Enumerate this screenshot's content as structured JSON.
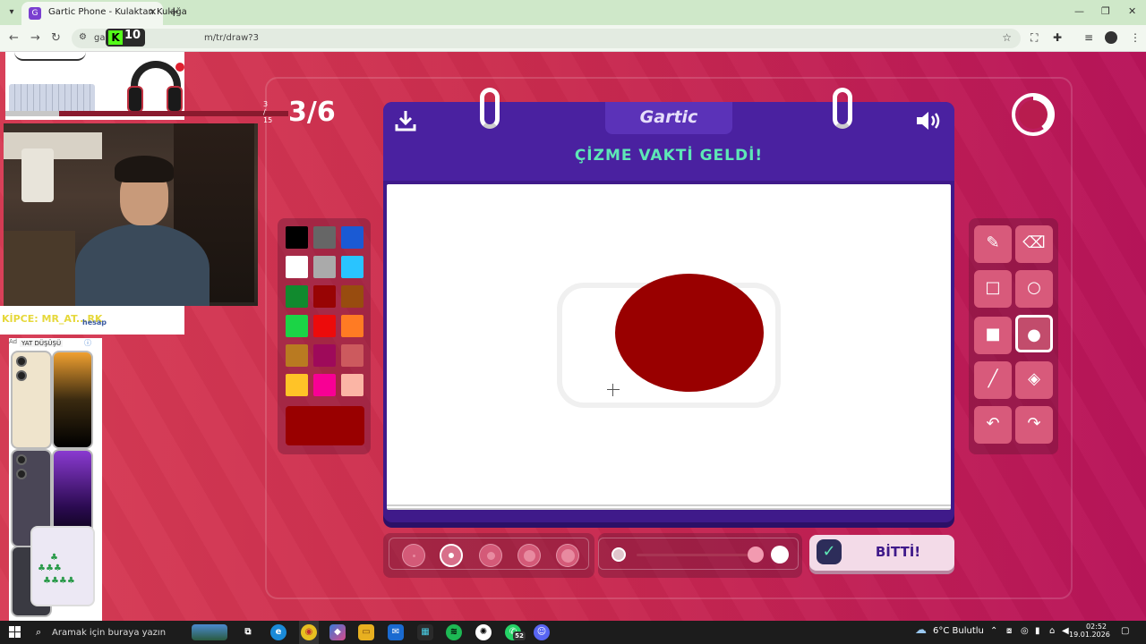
{
  "browser": {
    "tab_title": "Gartic Phone - Kulaktan Kulağa",
    "url_visible": "gart",
    "url_rest": "m/tr/draw?3",
    "kick_badge_number": "10"
  },
  "game": {
    "round": "3/6",
    "logo": "Gartic",
    "heading": "ÇİZME VAKTİ GELDİ!",
    "done_button": "BİTTİ!",
    "timer_elapsed_fraction": 0.6,
    "palette_colors": [
      "#000000",
      "#666666",
      "#1a5ad4",
      "#ffffff",
      "#aaaaaa",
      "#29c4ff",
      "#118a2e",
      "#980404",
      "#984c0f",
      "#1bd446",
      "#ec0b0b",
      "#ff7b23",
      "#b97a21",
      "#9e0a5a",
      "#cc5a5e",
      "#ffc327",
      "#f80094",
      "#fbb5a5"
    ],
    "selected_color": "#990000",
    "drawing": {
      "shape": "ellipse",
      "fill": "#990000"
    },
    "tools": [
      "pencil-icon",
      "eraser-icon",
      "rectangle-outline-icon",
      "circle-outline-icon",
      "rectangle-fill-icon",
      "circle-fill-icon",
      "line-icon",
      "bucket-icon",
      "undo-icon",
      "redo-icon"
    ],
    "selected_tool": "circle-fill-icon",
    "brush_sizes": 5,
    "selected_size_index": 1,
    "opacity_fraction": 0.95
  },
  "overlay": {
    "progress_text": "3 / 15",
    "progress_fraction": 0.2,
    "name_text": "KİPCE: MR_AT...RK",
    "hesap_text": "hesap",
    "ad_title": "YAT DÜŞÜŞÜ",
    "ad_badge": "Ad"
  },
  "taskbar": {
    "search_placeholder": "Aramak için buraya yazın",
    "weather": "6°C  Bulutlu",
    "time": "02:52",
    "date": "19.01.2026",
    "whatsapp_badge": "52"
  }
}
